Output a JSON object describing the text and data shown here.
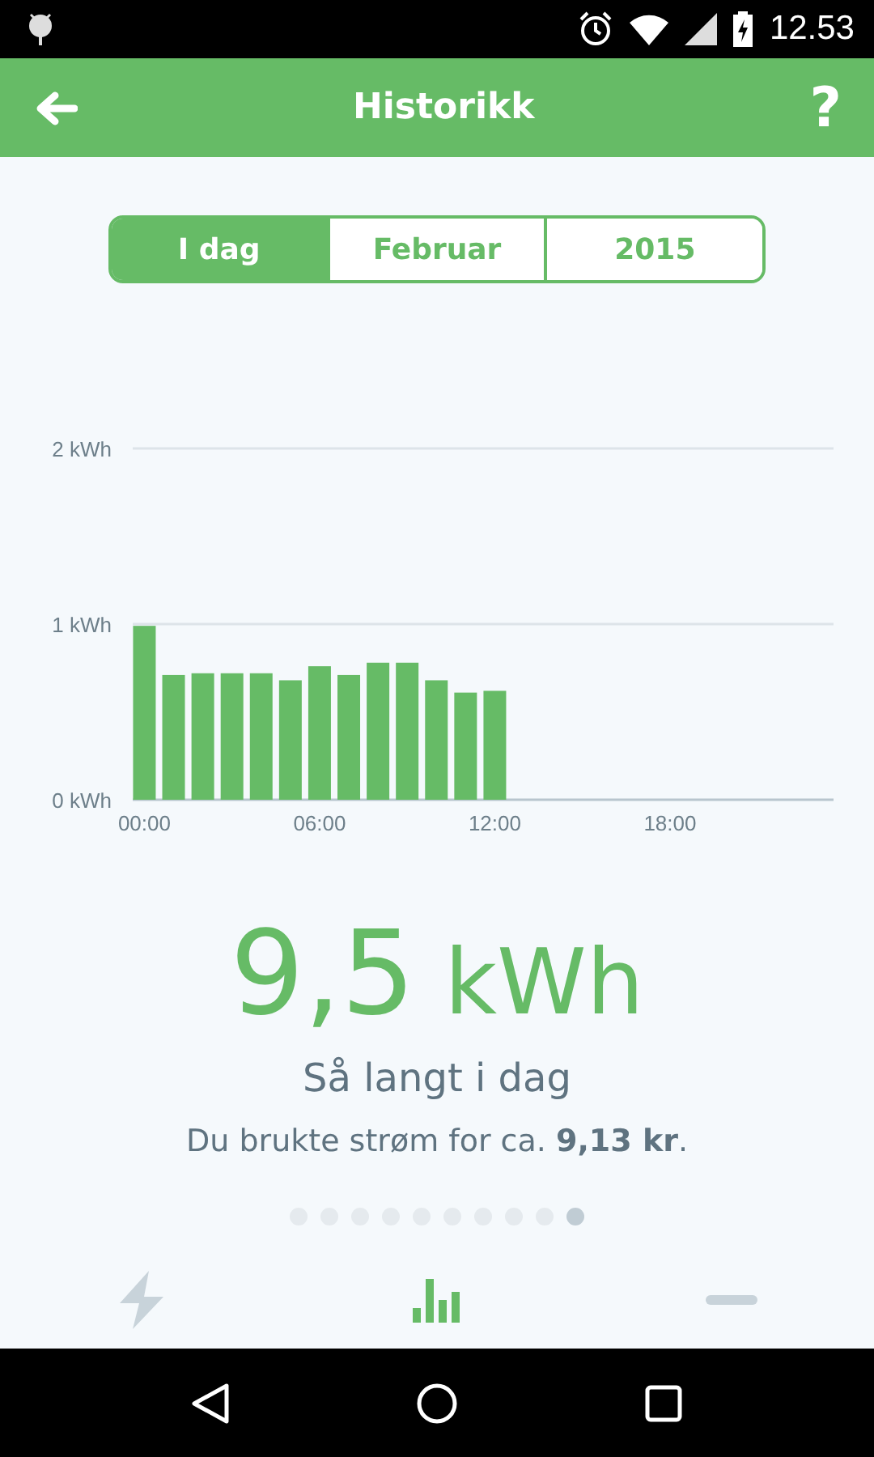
{
  "status_bar": {
    "time": "12.53"
  },
  "app_bar": {
    "title": "Historikk",
    "help": "?"
  },
  "tabs": [
    {
      "label": "I dag",
      "selected": true
    },
    {
      "label": "Februar",
      "selected": false
    },
    {
      "label": "2015",
      "selected": false
    }
  ],
  "chart_data": {
    "type": "bar",
    "x": [
      0,
      1,
      2,
      3,
      4,
      5,
      6,
      7,
      8,
      9,
      10,
      11,
      12
    ],
    "series": [
      {
        "color": "#66bb66",
        "values": [
          0.99,
          0.71,
          0.72,
          0.72,
          0.72,
          0.68,
          0.76,
          0.71,
          0.78,
          0.78,
          0.68,
          0.61,
          0.62
        ]
      }
    ],
    "ylim": [
      0,
      2
    ],
    "yticks": [
      {
        "value": 0,
        "label": "0 kWh"
      },
      {
        "value": 1,
        "label": "1 kWh"
      },
      {
        "value": 2,
        "label": "2 kWh"
      }
    ],
    "xticks": [
      {
        "value": 0,
        "label": "00:00"
      },
      {
        "value": 6,
        "label": "06:00"
      },
      {
        "value": 12,
        "label": "12:00"
      },
      {
        "value": 18,
        "label": "18:00"
      }
    ],
    "xlim": [
      -0.4,
      23.6
    ]
  },
  "total": {
    "value": "9,5",
    "unit": "kWh",
    "caption": "Så langt i dag",
    "cost": "Du brukte strøm for ca. **9,13 kr**."
  },
  "pages": [
    {
      "selected": false
    },
    {
      "selected": false
    },
    {
      "selected": false
    },
    {
      "selected": false
    },
    {
      "selected": false
    },
    {
      "selected": false
    },
    {
      "selected": false
    },
    {
      "selected": false
    },
    {
      "selected": false
    },
    {
      "selected": true
    }
  ],
  "bottom_tabs": [
    {
      "kind": "power",
      "selected": false
    },
    {
      "kind": "history",
      "selected": true
    },
    {
      "kind": "minus",
      "selected": false
    }
  ]
}
